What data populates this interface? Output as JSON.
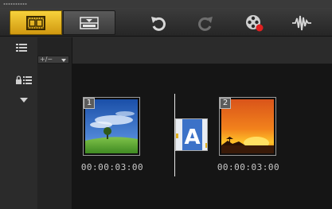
{
  "toolbar": {
    "views": [
      {
        "name": "storyboard-view",
        "active": true
      },
      {
        "name": "timeline-view",
        "active": false
      }
    ],
    "tools": [
      "undo-icon",
      "redo-icon",
      "record-capture-icon",
      "sound-mixer-icon"
    ]
  },
  "sidebar": {
    "icons": [
      "track-manager-icon",
      "lock-tracks-icon",
      "collapse-arrow-icon"
    ]
  },
  "zoom": {
    "label": "+∕−"
  },
  "clips": [
    {
      "number": "1",
      "duration": "00:00:03:00",
      "scene": "sky-and-tree"
    },
    {
      "number": "2",
      "duration": "00:00:03:00",
      "scene": "sunset"
    }
  ],
  "transition": {
    "label": "A"
  },
  "colors": {
    "accent": "#e8b820",
    "background": "#151515",
    "toolbar": "#2e2e2e"
  }
}
